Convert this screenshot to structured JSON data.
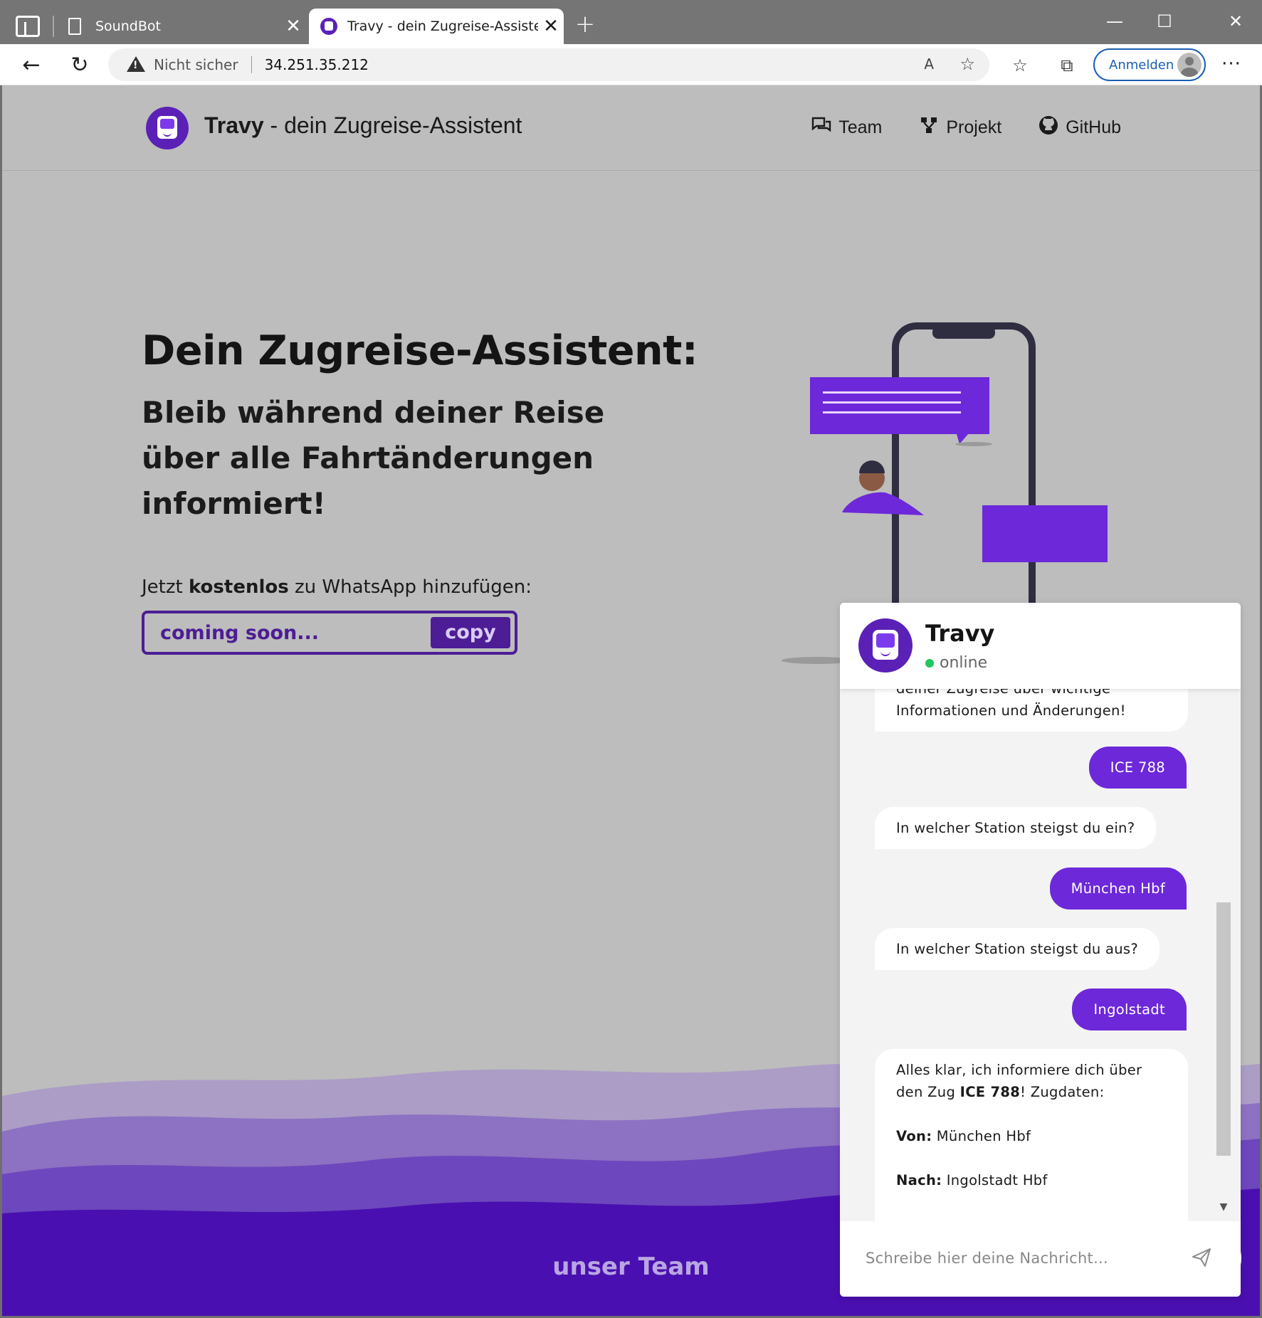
{
  "browser": {
    "tabs": [
      {
        "title": "SoundBot",
        "active": false
      },
      {
        "title": "Travy - dein Zugreise-Assistent",
        "active": true
      }
    ],
    "address": {
      "security_label": "Nicht sicher",
      "url": "34.251.35.212"
    },
    "signin_label": "Anmelden"
  },
  "site": {
    "brand_bold": "Travy",
    "brand_rest": " - dein Zugreise-Assistent",
    "nav": [
      {
        "label": "Team",
        "icon": "chat-bubbles-icon"
      },
      {
        "label": "Projekt",
        "icon": "project-graph-icon"
      },
      {
        "label": "GitHub",
        "icon": "github-icon"
      }
    ]
  },
  "hero": {
    "title": "Dein Zugreise-Assistent:",
    "subtitle": "Bleib während deiner Reise über alle Fahrtänderungen informiert!",
    "cta_prefix": "Jetzt ",
    "cta_bold": "kostenlos",
    "cta_suffix": " zu WhatsApp hinzufügen:",
    "code_value": "coming soon...",
    "copy_label": "copy"
  },
  "footer": {
    "team_title": "unser Team"
  },
  "chat": {
    "name": "Travy",
    "status": "online",
    "messages": [
      {
        "from": "bot",
        "text": "deiner Zugreise über wichtige Informationen und Änderungen!"
      },
      {
        "from": "user",
        "text": "ICE 788"
      },
      {
        "from": "bot",
        "text": "In welcher Station steigst du ein?"
      },
      {
        "from": "user",
        "text": "München Hbf"
      },
      {
        "from": "bot",
        "text": "In welcher Station steigst du aus?"
      },
      {
        "from": "user",
        "text": "Ingolstadt"
      }
    ],
    "summary": {
      "intro_prefix": "Alles klar, ich informiere dich über den Zug ",
      "train": "ICE 788",
      "intro_suffix": "! Zugdaten:",
      "from_label": "Von:",
      "from_value": " München Hbf",
      "to_label": "Nach:",
      "to_value": " Ingolstadt Hbf"
    },
    "input_placeholder": "Schreibe hier deine Nachricht..."
  },
  "colors": {
    "brand": "#5b21b6",
    "user_bubble": "#6d28d9",
    "online": "#22c55e",
    "wave_dark": "#4a0fb0"
  }
}
